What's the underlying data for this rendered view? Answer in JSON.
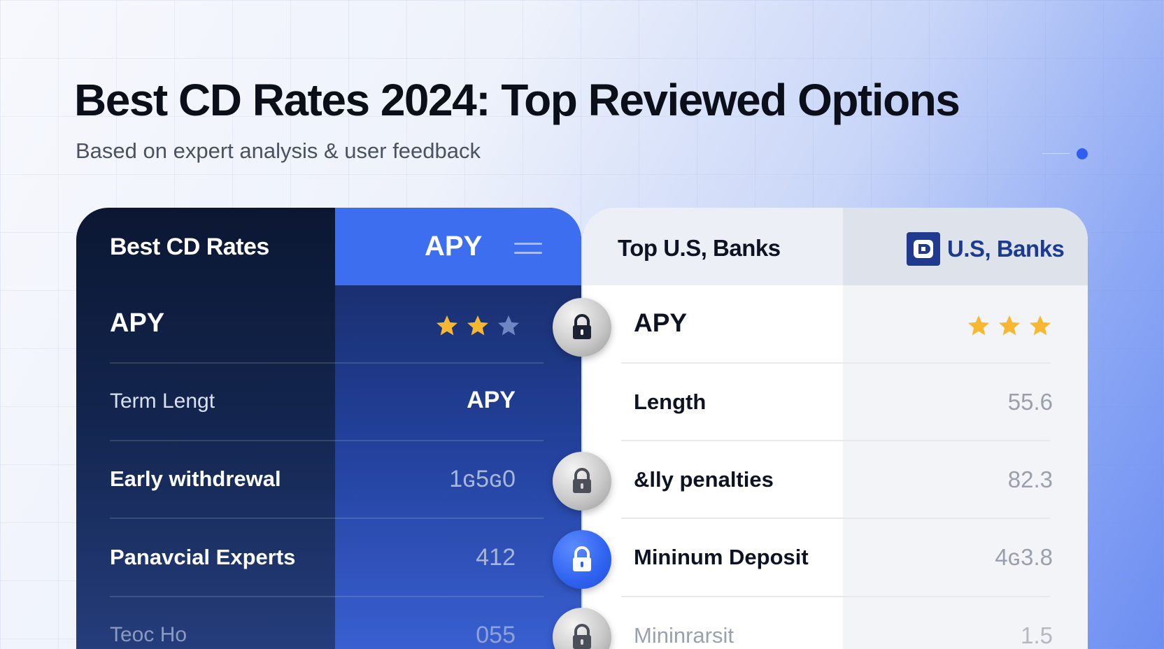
{
  "header": {
    "title": "Best CD Rates 2024: Top Reviewed Options",
    "subtitle": "Based on expert analysis & user feedback"
  },
  "left_panel": {
    "header_label": "Best CD Rates",
    "header_apy": "APY",
    "menu_icon": "menu-icon",
    "rows": [
      {
        "label": "APY",
        "stars_filled": 2,
        "stars_total": 3
      },
      {
        "label": "Term Lengt",
        "value": "APY"
      },
      {
        "label": "Early withdrewal",
        "value": "1ɢ5ɢ0"
      },
      {
        "label": "Panavcial Experts",
        "value": "412"
      },
      {
        "label": "Teoc Ho",
        "value": "055"
      }
    ]
  },
  "right_panel": {
    "header_label": "Top U.S, Banks",
    "bank_name": "U.S, Banks",
    "bank_logo_icon": "bank-logo-icon",
    "rows": [
      {
        "label": "APY",
        "stars_filled": 3,
        "stars_total": 3,
        "lock": "grey"
      },
      {
        "label": "Length",
        "value": "55.6"
      },
      {
        "label": "&lly penalties",
        "value": "82.3",
        "lock": "grey"
      },
      {
        "label": "Mininum Deposit",
        "value": "4ɢ3.8",
        "lock": "blue"
      },
      {
        "label": "Mininrarsit",
        "value": "1.5",
        "lock": "grey"
      }
    ]
  },
  "colors": {
    "accent_blue": "#3e6ef0",
    "dark_navy": "#0b1732",
    "star_gold": "#f7b731",
    "star_empty": "#6f86c4",
    "bank_blue": "#1d3b8e"
  }
}
